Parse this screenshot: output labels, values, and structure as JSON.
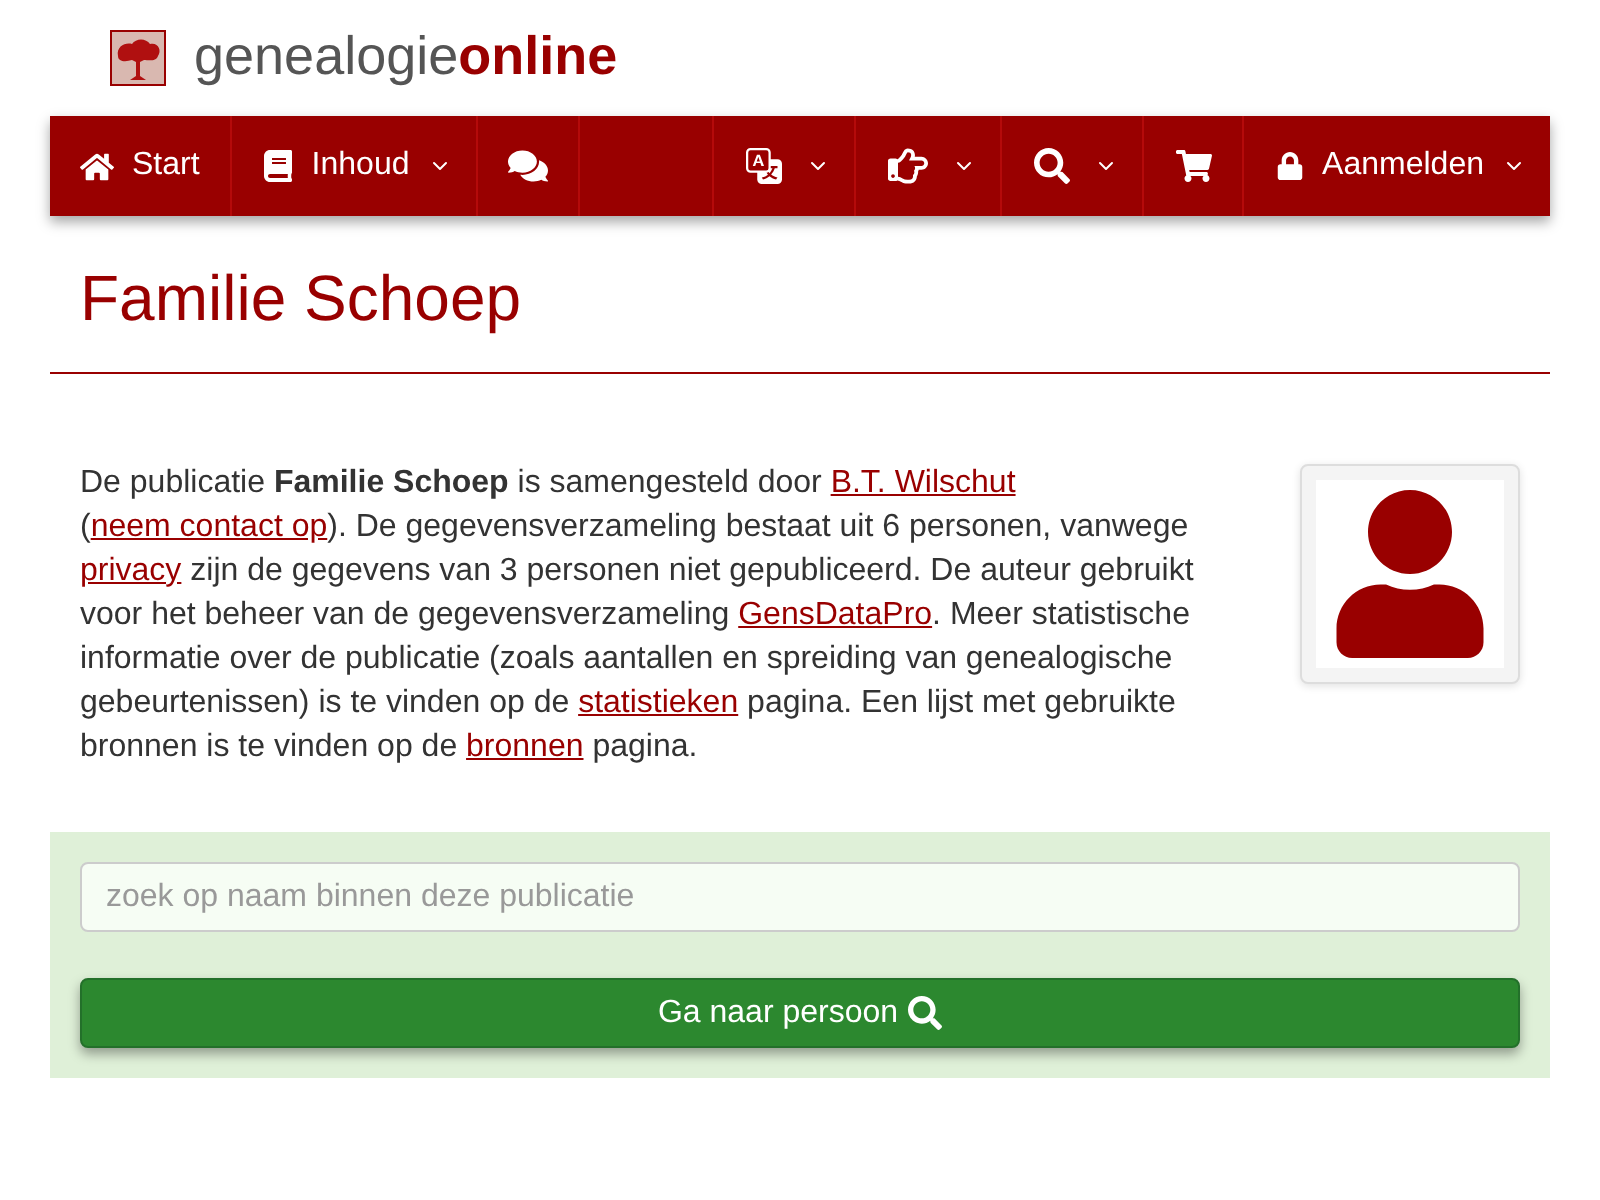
{
  "header": {
    "logo_text": "genealogie**online**"
  },
  "nav": {
    "left": [
      {
        "label": "Start",
        "dropdown": false
      },
      {
        "label": "Inhoud",
        "dropdown": true
      },
      {
        "dropdown": false
      }
    ],
    "right": [
      {
        "dropdown": true
      },
      {
        "dropdown": true
      },
      {
        "dropdown": true
      },
      {
        "dropdown": false
      },
      {
        "label": "Aanmelden",
        "dropdown": true
      }
    ]
  },
  "page": {
    "title": "Familie Schoep"
  },
  "intro": {
    "parts": [
      {
        "kind": "text",
        "text": "De publicatie **Familie Schoep** is samengesteld door "
      },
      {
        "kind": "link",
        "text": "B.T. Wilschut"
      },
      {
        "kind": "text",
        "text": " ("
      },
      {
        "kind": "link",
        "text": "neem contact op"
      },
      {
        "kind": "text",
        "text": "). De gegevensverzameling bestaat uit 6 personen, vanwege "
      },
      {
        "kind": "link",
        "text": "privacy"
      },
      {
        "kind": "text",
        "text": " zijn de gegevens van 3 personen niet gepubliceerd. De auteur gebruikt voor het beheer van de gegevensverzameling "
      },
      {
        "kind": "link",
        "text": "GensDataPro"
      },
      {
        "kind": "text",
        "text": ". Meer statistische informatie over de publicatie (zoals aantallen en spreiding van genealogische gebeurtenissen) is te vinden op de "
      },
      {
        "kind": "link",
        "text": "statistieken"
      },
      {
        "kind": "text",
        "text": " pagina. Een lijst met gebruikte bronnen is te vinden op de "
      },
      {
        "kind": "link",
        "text": "bronnen"
      },
      {
        "kind": "text",
        "text": " pagina."
      }
    ]
  },
  "search": {
    "placeholder": "zoek op naam binnen deze publicatie",
    "button": "Ga naar persoon"
  }
}
